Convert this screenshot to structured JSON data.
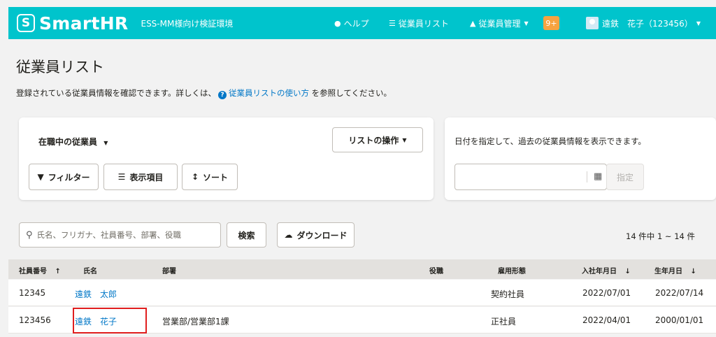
{
  "header": {
    "logo_mark": "S",
    "logo_text": "SmartHR",
    "tenant": "ESS-MM様向け検証環境",
    "help": "ヘルプ",
    "employee_list": "従業員リスト",
    "employee_management": "従業員管理",
    "notification_count": "9+",
    "user": "遠鉄　花子（123456）",
    "colors": {
      "brand": "#00c4cc",
      "badge": "#f7a340"
    }
  },
  "page": {
    "title": "従業員リスト",
    "description_before": "登録されている従業員情報を確認できます。詳しくは、",
    "description_link": "従業員リストの使い方",
    "description_after": "を参照してください。"
  },
  "filters": {
    "status": "在職中の従業員",
    "list_actions": "リストの操作",
    "filter": "フィルター",
    "display_items": "表示項目",
    "sort": "ソート"
  },
  "date_panel": {
    "note": "日付を指定して、過去の従業員情報を表示できます。",
    "input_value": "",
    "apply": "指定"
  },
  "search": {
    "placeholder": "氏名、フリガナ、社員番号、部署、役職",
    "search_button": "検索",
    "download_button": "ダウンロード",
    "count": "14 件中 1 ~ 14 件"
  },
  "table": {
    "headers": {
      "employee_number": "社員番号",
      "name": "氏名",
      "department": "部署",
      "position": "役職",
      "employment_type": "雇用形態",
      "hire_date": "入社年月日",
      "birth_date": "生年月日"
    },
    "rows": [
      {
        "employee_number": "12345",
        "name": "遠鉄　太郎",
        "department": "",
        "position": "",
        "employment_type": "契約社員",
        "hire_date": "2022/07/01",
        "birth_date": "2022/07/14"
      },
      {
        "employee_number": "123456",
        "name": "遠鉄　花子",
        "department": "営業部/営業部1課",
        "position": "",
        "employment_type": "正社員",
        "hire_date": "2022/04/01",
        "birth_date": "2000/01/01"
      }
    ]
  }
}
